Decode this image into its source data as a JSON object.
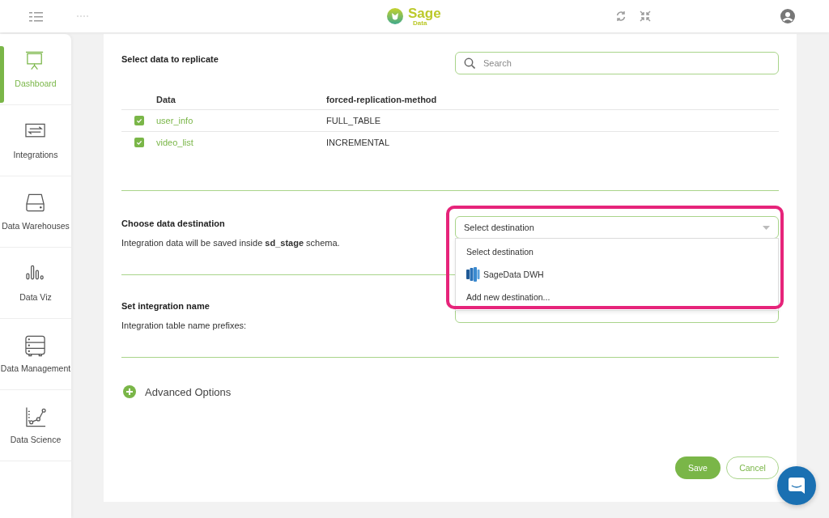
{
  "header": {
    "logo": {
      "name": "Sage",
      "sub": "Data"
    }
  },
  "sidebar": {
    "items": [
      {
        "label": "Dashboard",
        "selected": true
      },
      {
        "label": "Integrations",
        "selected": false
      },
      {
        "label": "Data Warehouses",
        "selected": false
      },
      {
        "label": "Data Viz",
        "selected": false
      },
      {
        "label": "Data Management",
        "selected": false
      },
      {
        "label": "Data Science",
        "selected": false
      }
    ]
  },
  "replicate": {
    "title": "Select data to replicate",
    "search": {
      "placeholder": "Search"
    },
    "columns": [
      "Data",
      "forced-replication-method"
    ],
    "rows": [
      {
        "checked": true,
        "name": "user_info",
        "method": "FULL_TABLE"
      },
      {
        "checked": true,
        "name": "video_list",
        "method": "INCREMENTAL"
      }
    ]
  },
  "destination": {
    "title": "Choose data destination",
    "description": "Integration data will be saved inside **sd_stage** schema.",
    "select": {
      "value": "Select destination",
      "expanded": true,
      "highlighted": true
    },
    "options": [
      {
        "label": "Select destination",
        "kind": "text"
      },
      {
        "label": "SageData DWH",
        "kind": "warehouse"
      },
      {
        "label": "Add new destination...",
        "kind": "text"
      }
    ]
  },
  "integration_name": {
    "title": "Set integration name",
    "description": "Integration table name prefixes:"
  },
  "advanced": {
    "label": "Advanced Options"
  },
  "buttons": [
    {
      "label": "Save",
      "kind": "primary"
    },
    {
      "label": "Cancel",
      "kind": "secondary"
    }
  ]
}
